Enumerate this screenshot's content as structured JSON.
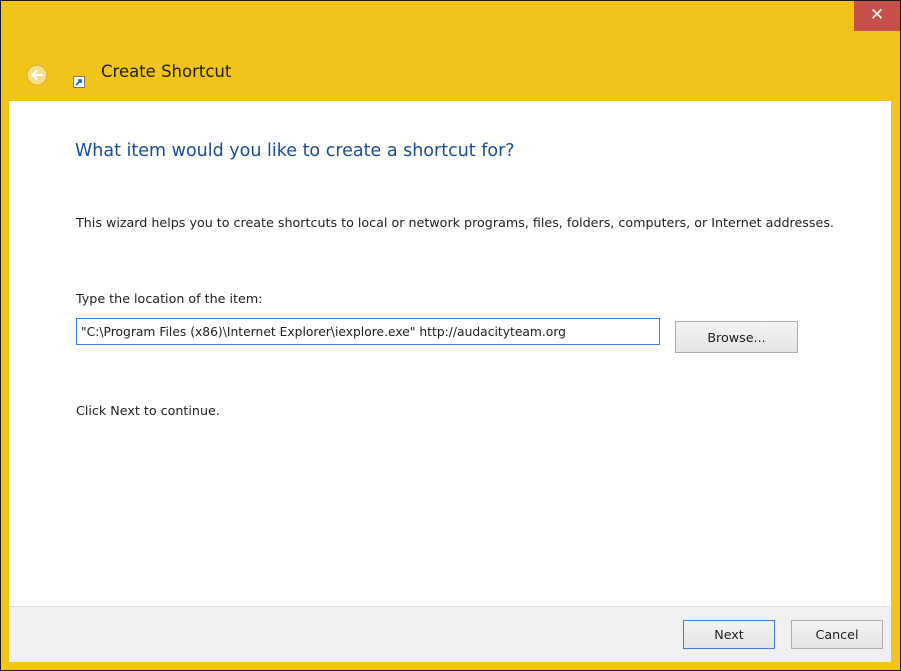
{
  "window": {
    "close_glyph": "✕",
    "accent_color": "#f0c419",
    "close_color": "#c7504b"
  },
  "header": {
    "title": "Create Shortcut",
    "back_icon": "back-arrow-icon",
    "app_icon": "shortcut-icon"
  },
  "main": {
    "heading": "What item would you like to create a shortcut for?",
    "intro": "This wizard helps you to create shortcuts to local or network programs, files, folders, computers, or Internet addresses.",
    "location_label": "Type the location of the item:",
    "location_value": "\"C:\\Program Files (x86)\\Internet Explorer\\iexplore.exe\" http://audacityteam.org",
    "browse_label": "Browse...",
    "continue_text": "Click Next to continue.",
    "heading_color": "#1a4b9b"
  },
  "footer": {
    "next_label": "Next",
    "cancel_label": "Cancel"
  }
}
